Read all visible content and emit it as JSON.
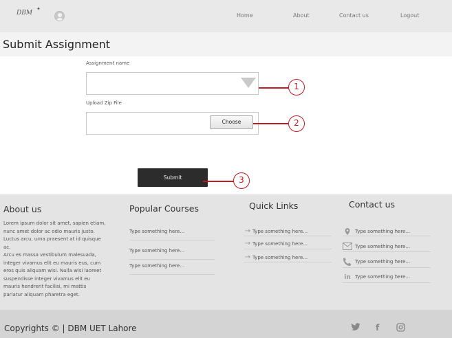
{
  "header": {
    "logo": "DBM",
    "logo_star": "✦",
    "nav": [
      "Home",
      "About",
      "Contact us",
      "Logout"
    ]
  },
  "page": {
    "title": "Submit  Assignment"
  },
  "form": {
    "assignment_label": "Assignment name",
    "upload_label": "Upload Zip File",
    "choose_label": "Choose",
    "submit_label": "Submit",
    "callouts": [
      "1",
      "2",
      "3"
    ]
  },
  "footer": {
    "about": {
      "heading": "About us",
      "para1": "Lorem ipsum dolor sit amet, sapien etiam, nunc amet dolor ac odio mauris justo. Luctus arcu, urna praesent at id quisque ac.",
      "para2": "Arcu es massa vestibulum malesuada, integer vivamus elit eu mauris eus, cum eros quis aliquam wisi. Nulla wisi laoreet suspendisse integer vivamus elit eu mauris hendrerit facilisi, mi mattis pariatur aliquam pharetra eget."
    },
    "courses": {
      "heading": "Popular Courses",
      "items": [
        "Type something here...",
        "Type something here...",
        "Type something here..."
      ]
    },
    "quick_links": {
      "heading": "Quick Links",
      "items": [
        "Type something here...",
        "Type something here...",
        "Type something here..."
      ]
    },
    "contact": {
      "heading": "Contact us",
      "items": [
        {
          "icon": "location-pin-icon",
          "text": "Type something here..."
        },
        {
          "icon": "envelope-icon",
          "text": "Type something here..."
        },
        {
          "icon": "phone-icon",
          "text": "Type something here..."
        },
        {
          "icon": "linkedin-icon",
          "text": "Type something here..."
        }
      ]
    }
  },
  "bottom": {
    "copyright": "Copyrights © | DBM UET Lahore",
    "social": [
      "twitter-icon",
      "facebook-icon",
      "instagram-icon"
    ]
  },
  "colors": {
    "accent": "#c0191f",
    "submit_bg": "#2c2c2c",
    "footer_bg": "#e4e4e4"
  }
}
